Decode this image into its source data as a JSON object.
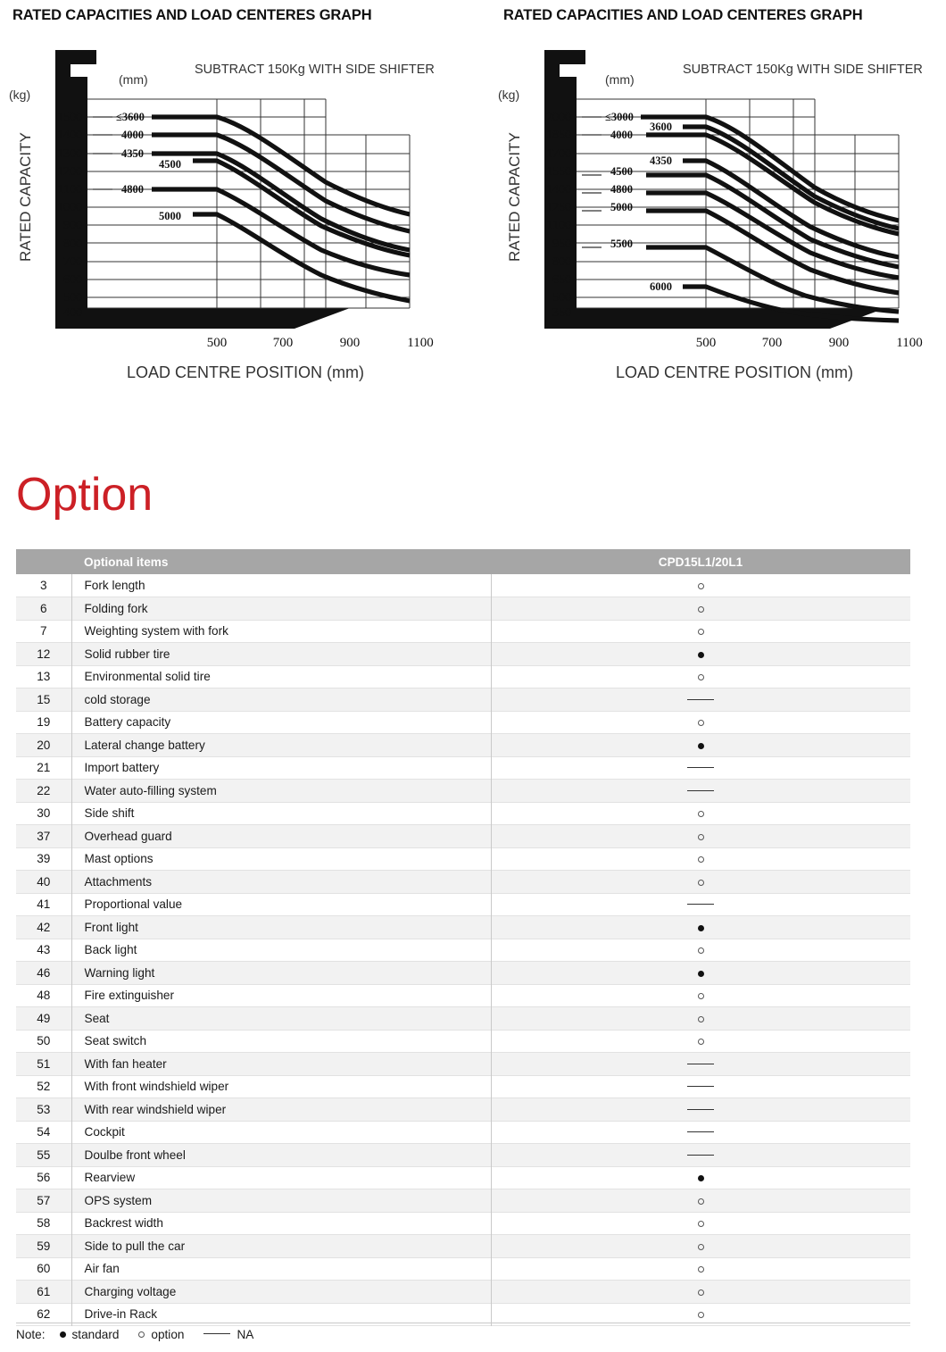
{
  "charts": [
    {
      "title": "RATED CAPACITIES AND LOAD CENTERES GRAPH",
      "note": "SUBTRACT  150Kg  WITH  SIDE  SHIFTER",
      "unit_y": "(kg)",
      "unit_series": "(mm)",
      "ylabel": "RATED  CAPACITY",
      "xlabel": "LOAD  CENTRE  POSITION (mm)",
      "yticks": [
        "1500",
        "1400",
        "1300",
        "1200",
        "1100",
        "1000",
        "900",
        "800",
        "700",
        "600",
        "500",
        "400"
      ],
      "xticks": [
        "500",
        "700",
        "900",
        "1100"
      ],
      "series_labels": [
        "≤3600",
        "4000",
        "4350",
        "4500",
        "4800",
        "5000"
      ]
    },
    {
      "title": "RATED CAPACITIES AND LOAD CENTERES GRAPH",
      "note": "SUBTRACT  150Kg  WITH  SIDE  SHIFTER",
      "unit_y": "(kg)",
      "unit_series": "(mm)",
      "ylabel": "RATED  CAPACITY",
      "xlabel": "LOAD  CENTRE  POSITION (mm)",
      "yticks": [
        "2000",
        "1850",
        "1700",
        "1550",
        "1400",
        "1250",
        "1100",
        "950",
        "800",
        "650",
        "500",
        "350"
      ],
      "xticks": [
        "500",
        "700",
        "900",
        "1100"
      ],
      "series_labels": [
        "≤3000",
        "3600",
        "4000",
        "4350",
        "4500",
        "4800",
        "5000",
        "5500",
        "6000"
      ]
    }
  ],
  "chart_data": [
    {
      "type": "line",
      "title": "RATED CAPACITIES AND LOAD CENTERES GRAPH",
      "subtitle": "SUBTRACT 150Kg WITH SIDE SHIFTER",
      "xlabel": "LOAD CENTRE POSITION (mm)",
      "ylabel": "RATED CAPACITY (kg)",
      "xlim": [
        300,
        1100
      ],
      "ylim": [
        400,
        1500
      ],
      "xticks": [
        500,
        700,
        900,
        1100
      ],
      "yticks": [
        400,
        500,
        600,
        700,
        800,
        900,
        1000,
        1100,
        1200,
        1300,
        1400,
        1500
      ],
      "grid": true,
      "legend": "inline-labels",
      "x": [
        300,
        500,
        700,
        900,
        1100
      ],
      "series": [
        {
          "name": "≤3600",
          "values": [
            1500,
            1500,
            1180,
            990,
            900
          ]
        },
        {
          "name": "4000",
          "values": [
            1400,
            1400,
            1120,
            940,
            850
          ]
        },
        {
          "name": "4350",
          "values": [
            1300,
            1300,
            1040,
            870,
            790
          ]
        },
        {
          "name": "4500",
          "values": [
            1260,
            1260,
            1010,
            850,
            770
          ]
        },
        {
          "name": "4800",
          "values": [
            1100,
            1100,
            880,
            740,
            670
          ]
        },
        {
          "name": "5000",
          "values": [
            950,
            950,
            760,
            630,
            540
          ]
        }
      ]
    },
    {
      "type": "line",
      "title": "RATED CAPACITIES AND LOAD CENTERES GRAPH",
      "subtitle": "SUBTRACT 150Kg WITH SIDE SHIFTER",
      "xlabel": "LOAD CENTRE POSITION (mm)",
      "ylabel": "RATED CAPACITY (kg)",
      "xlim": [
        300,
        1100
      ],
      "ylim": [
        350,
        2000
      ],
      "xticks": [
        500,
        700,
        900,
        1100
      ],
      "yticks": [
        350,
        500,
        650,
        800,
        950,
        1100,
        1250,
        1400,
        1550,
        1700,
        1850,
        2000
      ],
      "grid": true,
      "legend": "inline-labels",
      "x": [
        300,
        500,
        700,
        900,
        1100
      ],
      "series": [
        {
          "name": "≤3000",
          "values": [
            2000,
            2000,
            1620,
            1330,
            1180
          ]
        },
        {
          "name": "3600",
          "values": [
            1925,
            1925,
            1560,
            1280,
            1140
          ]
        },
        {
          "name": "4000",
          "values": [
            1850,
            1850,
            1500,
            1230,
            1100
          ]
        },
        {
          "name": "4350",
          "values": [
            1630,
            1630,
            1320,
            1080,
            960
          ]
        },
        {
          "name": "4500",
          "values": [
            1550,
            1550,
            1250,
            1020,
            910
          ]
        },
        {
          "name": "4800",
          "values": [
            1400,
            1400,
            1130,
            920,
            820
          ]
        },
        {
          "name": "5000",
          "values": [
            1250,
            1250,
            1000,
            810,
            720
          ]
        },
        {
          "name": "5500",
          "values": [
            950,
            950,
            750,
            600,
            520
          ]
        },
        {
          "name": "6000",
          "values": [
            575,
            575,
            460,
            400,
            370
          ]
        }
      ]
    }
  ],
  "section": {
    "heading": "Option"
  },
  "table": {
    "headers": {
      "num": "",
      "item": "Optional items",
      "model": "CPD15L1/20L1"
    },
    "rows": [
      {
        "num": "3",
        "item": "Fork length",
        "mark": "option"
      },
      {
        "num": "6",
        "item": "Folding fork",
        "mark": "option"
      },
      {
        "num": "7",
        "item": "Weighting system with fork",
        "mark": "option"
      },
      {
        "num": "12",
        "item": "Solid rubber tire",
        "mark": "standard"
      },
      {
        "num": "13",
        "item": "Environmental solid tire",
        "mark": "option"
      },
      {
        "num": "15",
        "item": "cold storage",
        "mark": "na"
      },
      {
        "num": "19",
        "item": "Battery capacity",
        "mark": "option"
      },
      {
        "num": "20",
        "item": "Lateral change battery",
        "mark": "standard"
      },
      {
        "num": "21",
        "item": "Import battery",
        "mark": "na"
      },
      {
        "num": "22",
        "item": "Water auto-filling system",
        "mark": "na"
      },
      {
        "num": "30",
        "item": "Side shift",
        "mark": "option"
      },
      {
        "num": "37",
        "item": "Overhead guard",
        "mark": "option"
      },
      {
        "num": "39",
        "item": "Mast options",
        "mark": "option"
      },
      {
        "num": "40",
        "item": "Attachments",
        "mark": "option"
      },
      {
        "num": "41",
        "item": "Proportional value",
        "mark": "na"
      },
      {
        "num": "42",
        "item": "Front light",
        "mark": "standard"
      },
      {
        "num": "43",
        "item": "Back light",
        "mark": "option"
      },
      {
        "num": "46",
        "item": "Warning light",
        "mark": "standard"
      },
      {
        "num": "48",
        "item": "Fire extinguisher",
        "mark": "option"
      },
      {
        "num": "49",
        "item": "Seat",
        "mark": "option"
      },
      {
        "num": "50",
        "item": "Seat switch",
        "mark": "option"
      },
      {
        "num": "51",
        "item": "With fan heater",
        "mark": "na"
      },
      {
        "num": "52",
        "item": "With front windshield wiper",
        "mark": "na"
      },
      {
        "num": "53",
        "item": "With rear windshield wiper",
        "mark": "na"
      },
      {
        "num": "54",
        "item": "Cockpit",
        "mark": "na"
      },
      {
        "num": "55",
        "item": "Doulbe front wheel",
        "mark": "na"
      },
      {
        "num": "56",
        "item": "Rearview",
        "mark": "standard"
      },
      {
        "num": "57",
        "item": "OPS system",
        "mark": "option"
      },
      {
        "num": "58",
        "item": "Backrest width",
        "mark": "option"
      },
      {
        "num": "59",
        "item": "Side to pull the car",
        "mark": "option"
      },
      {
        "num": "60",
        "item": "Air fan",
        "mark": "option"
      },
      {
        "num": "61",
        "item": "Charging voltage",
        "mark": "option"
      },
      {
        "num": "62",
        "item": "Drive-in Rack",
        "mark": "option"
      }
    ]
  },
  "note": {
    "label": "Note:",
    "standard_text": "standard",
    "option_text": "option",
    "na_text": "NA"
  },
  "colors": {
    "heading_red": "#cc2026",
    "table_header_bg": "#a6a6a6",
    "row_alt_bg": "#f2f2f2",
    "ink": "#111111"
  }
}
